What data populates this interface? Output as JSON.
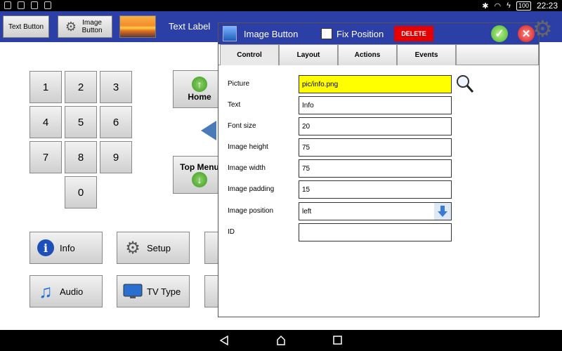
{
  "status_bar": {
    "battery": "100",
    "time": "22:23"
  },
  "toolbar": {
    "text_button": "Text Button",
    "image_button": "Image Button",
    "text_label": "Text Label"
  },
  "keypad": {
    "keys": [
      "1",
      "2",
      "3",
      "4",
      "5",
      "6",
      "7",
      "8",
      "9",
      "0"
    ]
  },
  "nav": {
    "home": "Home",
    "top_menu": "Top Menu"
  },
  "grid_buttons": {
    "info": "Info",
    "setup": "Setup",
    "audio": "Audio",
    "tv_type": "TV Type"
  },
  "dialog": {
    "title": "Image Button",
    "fix_position": "Fix Position",
    "delete": "DELETE",
    "tabs": [
      "Control",
      "Layout",
      "Actions",
      "Events"
    ],
    "fields": {
      "picture": {
        "label": "Picture",
        "value": "pic/info.png"
      },
      "text": {
        "label": "Text",
        "value": "Info"
      },
      "font_size": {
        "label": "Font size",
        "value": "20"
      },
      "image_height": {
        "label": "Image height",
        "value": "75"
      },
      "image_width": {
        "label": "Image width",
        "value": "75"
      },
      "image_padding": {
        "label": "Image padding",
        "value": "15"
      },
      "image_position": {
        "label": "Image position",
        "value": "left"
      },
      "id": {
        "label": "ID",
        "value": ""
      }
    }
  },
  "colors": {
    "toolbar_bg": "#2c3fa6",
    "delete_bg": "#e50000",
    "picture_field_bg": "#ffff00"
  }
}
